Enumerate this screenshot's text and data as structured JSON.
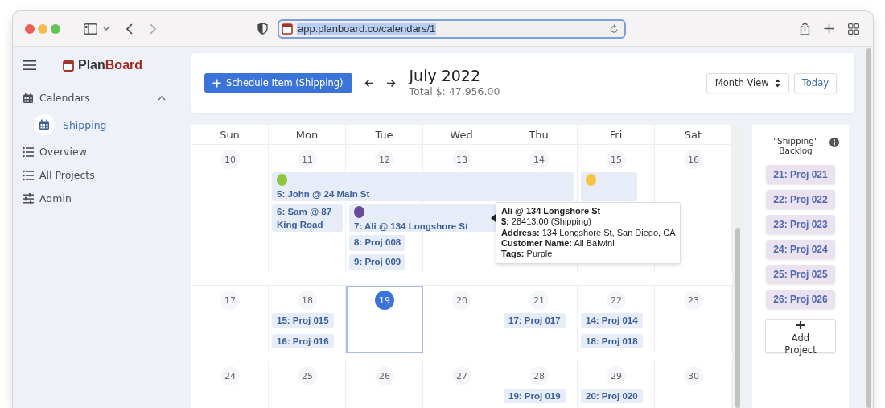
{
  "browser": {
    "url": "app.planboard.co/calendars/1"
  },
  "sidebar": {
    "logo": {
      "part_1": "Plan",
      "part_2": "Board"
    },
    "items": [
      {
        "label": "Calendars",
        "kind": "group",
        "expanded": true,
        "children": [
          {
            "label": "Shipping",
            "selected": true
          }
        ]
      },
      {
        "label": "Overview",
        "kind": "list"
      },
      {
        "label": "All Projects",
        "kind": "list"
      },
      {
        "label": "Admin",
        "kind": "sliders"
      }
    ]
  },
  "header": {
    "schedule_button": "Schedule Item (Shipping)",
    "title": "July 2022",
    "total": "Total $: 47,956.00",
    "view_select": "Month View",
    "today_button": "Today"
  },
  "calendar": {
    "weekdays": [
      "Sun",
      "Mon",
      "Tue",
      "Wed",
      "Thu",
      "Fri",
      "Sat"
    ],
    "weeks": [
      {
        "days": [
          {
            "label": "10",
            "today": false
          },
          {
            "label": "11",
            "today": false,
            "events": [
              {
                "label": "5: John @ 24 Main St",
                "color": "#8cc63f",
                "kind": "four-day"
              },
              {
                "label": "6: Sam @ 87 King Road",
                "kind": "single"
              }
            ]
          },
          {
            "label": "12",
            "today": false,
            "events": [
              {
                "label": "7: Ali @ 134 Longshore St",
                "color": "#6a4a9c",
                "kind": "two-day"
              },
              {
                "label": "8: Proj 008",
                "kind": "single"
              },
              {
                "label": "9: Proj 009",
                "kind": "single"
              }
            ]
          },
          {
            "label": "13",
            "today": false
          },
          {
            "label": "14",
            "today": false
          },
          {
            "label": "15",
            "today": false,
            "events": [
              {
                "color": "#f5c242",
                "kind": "single"
              }
            ]
          },
          {
            "label": "16",
            "today": false
          }
        ]
      },
      {
        "days": [
          {
            "label": "17",
            "today": false
          },
          {
            "label": "18",
            "today": false,
            "events": [
              {
                "label": "15: Proj 015",
                "kind": "single"
              },
              {
                "label": "16: Proj 016",
                "kind": "single"
              }
            ]
          },
          {
            "label": "19",
            "today": true
          },
          {
            "label": "20",
            "today": false
          },
          {
            "label": "21",
            "today": false,
            "events": [
              {
                "label": "17: Proj 017",
                "kind": "single"
              }
            ]
          },
          {
            "label": "22",
            "today": false,
            "events": [
              {
                "label": "14: Proj 014",
                "kind": "single"
              },
              {
                "label": "18: Proj 018",
                "kind": "single"
              }
            ]
          },
          {
            "label": "23",
            "today": false
          }
        ]
      },
      {
        "days": [
          {
            "label": "24",
            "today": false
          },
          {
            "label": "25",
            "today": false
          },
          {
            "label": "26",
            "today": false
          },
          {
            "label": "27",
            "today": false
          },
          {
            "label": "28",
            "today": false,
            "events": [
              {
                "label": "19: Proj 019",
                "kind": "single"
              }
            ]
          },
          {
            "label": "29",
            "today": false,
            "events": [
              {
                "label": "20: Proj 020",
                "kind": "single"
              }
            ]
          },
          {
            "label": "30",
            "today": false
          }
        ]
      }
    ],
    "tooltip": {
      "title": "Ali @ 134 Longshore St",
      "lines": [
        "**$:** 28413.00 (Shipping)",
        "**Address:** 134 Longshore St, San Diego, CA",
        "**Customer Name:** Ali Balwini",
        "**Tags:** Purple"
      ]
    }
  },
  "backlog": {
    "title": "\"Shipping\" Backlog",
    "items": [
      "21: Proj 021",
      "22: Proj 022",
      "23: Proj 023",
      "24: Proj 024",
      "25: Proj 025",
      "26: Proj 026"
    ],
    "add_button": "Add Project"
  }
}
